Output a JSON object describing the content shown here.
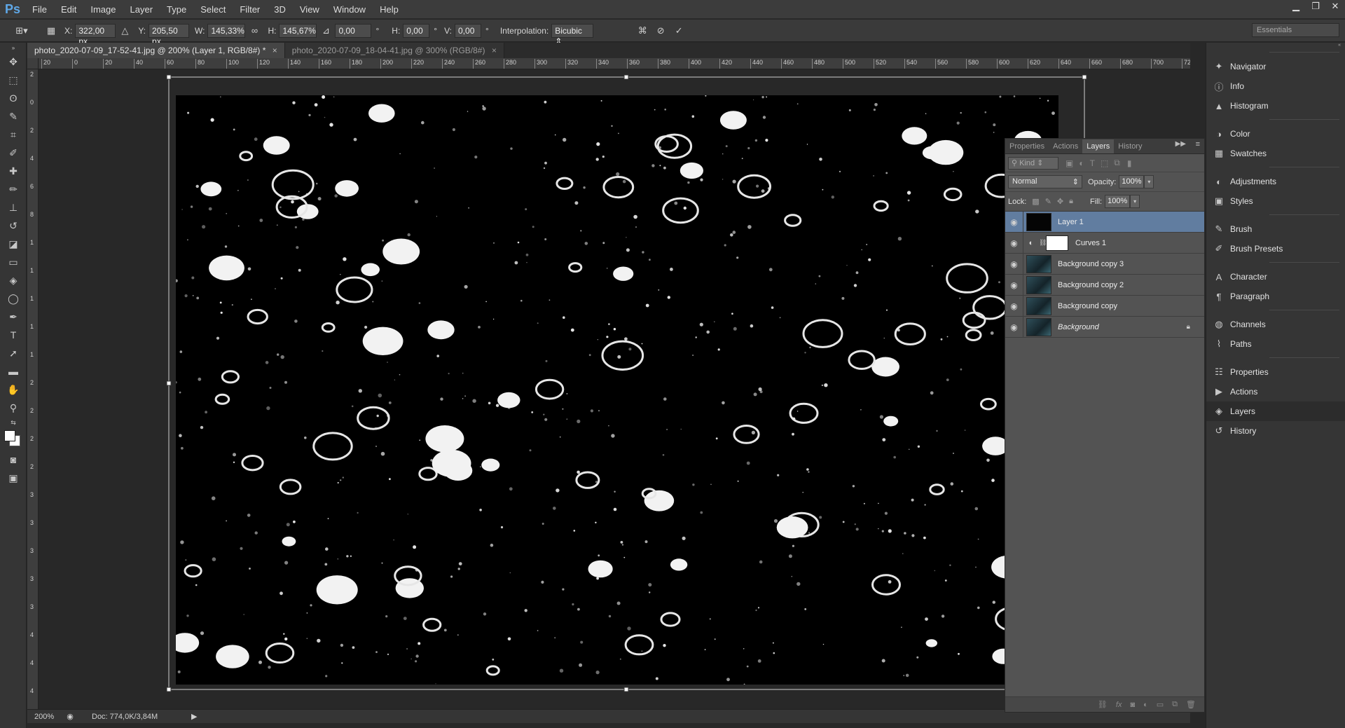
{
  "app": {
    "logo": "Ps"
  },
  "menu": [
    "File",
    "Edit",
    "Image",
    "Layer",
    "Type",
    "Select",
    "Filter",
    "3D",
    "View",
    "Window",
    "Help"
  ],
  "options": {
    "x_label": "X:",
    "x_value": "322,00 px",
    "y_label": "Y:",
    "y_value": "205,50 px",
    "w_label": "W:",
    "w_value": "145,33%",
    "h_label": "H:",
    "h_value": "145,67%",
    "rotate_value": "0,00",
    "hskew_label": "H:",
    "hskew_value": "0,00",
    "vskew_label": "V:",
    "vskew_value": "0,00",
    "degree": "°",
    "interp_label": "Interpolation:",
    "interp_value": "Bicubic",
    "workspace": "Essentials"
  },
  "tabs": [
    {
      "label": "photo_2020-07-09_17-52-41.jpg @ 200% (Layer 1, RGB/8#) *",
      "active": true
    },
    {
      "label": "photo_2020-07-09_18-04-41.jpg @ 300% (RGB/8#)",
      "active": false
    }
  ],
  "ruler_h": [
    "20",
    "0",
    "20",
    "40",
    "60",
    "80",
    "100",
    "120",
    "140",
    "160",
    "180",
    "200",
    "220",
    "240",
    "260",
    "280",
    "300",
    "320",
    "340",
    "360",
    "380",
    "400",
    "420",
    "440",
    "460",
    "480",
    "500",
    "520",
    "540",
    "560",
    "580",
    "600",
    "620",
    "640",
    "660",
    "680",
    "700",
    "72"
  ],
  "ruler_v": [
    "2",
    "0",
    "2",
    "4",
    "6",
    "8",
    "1",
    "1",
    "1",
    "1",
    "1",
    "2",
    "2",
    "2",
    "2",
    "3",
    "3",
    "3",
    "3",
    "3",
    "4",
    "4",
    "4"
  ],
  "status": {
    "zoom": "200%",
    "doc": "Doc: 774,0K/3,84M"
  },
  "layers_panel": {
    "tabs": [
      "Properties",
      "Actions",
      "Layers",
      "History"
    ],
    "kind_label": "Kind",
    "blend_mode": "Normal",
    "opacity_label": "Opacity:",
    "opacity_value": "100%",
    "lock_label": "Lock:",
    "fill_label": "Fill:",
    "fill_value": "100%",
    "layers": [
      {
        "name": "Layer 1",
        "selected": true,
        "thumb": "dark"
      },
      {
        "name": "Curves 1",
        "selected": false,
        "thumb": "adjust"
      },
      {
        "name": "Background copy 3",
        "selected": false,
        "thumb": "photo"
      },
      {
        "name": "Background copy 2",
        "selected": false,
        "thumb": "photo"
      },
      {
        "name": "Background copy",
        "selected": false,
        "thumb": "photo"
      },
      {
        "name": "Background",
        "selected": false,
        "thumb": "photo",
        "locked": true
      }
    ]
  },
  "dock": [
    {
      "group": [
        {
          "label": "Navigator",
          "icon": "navigator-icon"
        },
        {
          "label": "Info",
          "icon": "info-icon"
        },
        {
          "label": "Histogram",
          "icon": "histogram-icon"
        }
      ]
    },
    {
      "group": [
        {
          "label": "Color",
          "icon": "color-icon"
        },
        {
          "label": "Swatches",
          "icon": "swatches-icon"
        }
      ]
    },
    {
      "group": [
        {
          "label": "Adjustments",
          "icon": "adjustments-icon"
        },
        {
          "label": "Styles",
          "icon": "styles-icon"
        }
      ]
    },
    {
      "group": [
        {
          "label": "Brush",
          "icon": "brush-icon"
        },
        {
          "label": "Brush Presets",
          "icon": "brush-presets-icon"
        }
      ]
    },
    {
      "group": [
        {
          "label": "Character",
          "icon": "character-icon"
        },
        {
          "label": "Paragraph",
          "icon": "paragraph-icon"
        }
      ]
    },
    {
      "group": [
        {
          "label": "Channels",
          "icon": "channels-icon"
        },
        {
          "label": "Paths",
          "icon": "paths-icon"
        }
      ]
    },
    {
      "group": [
        {
          "label": "Properties",
          "icon": "properties-icon"
        },
        {
          "label": "Actions",
          "icon": "actions-icon"
        },
        {
          "label": "Layers",
          "icon": "layers-icon",
          "active": true
        },
        {
          "label": "History",
          "icon": "history-icon"
        }
      ]
    }
  ],
  "colors": {
    "accent": "#617da0",
    "logo": "#5fa8e8"
  }
}
